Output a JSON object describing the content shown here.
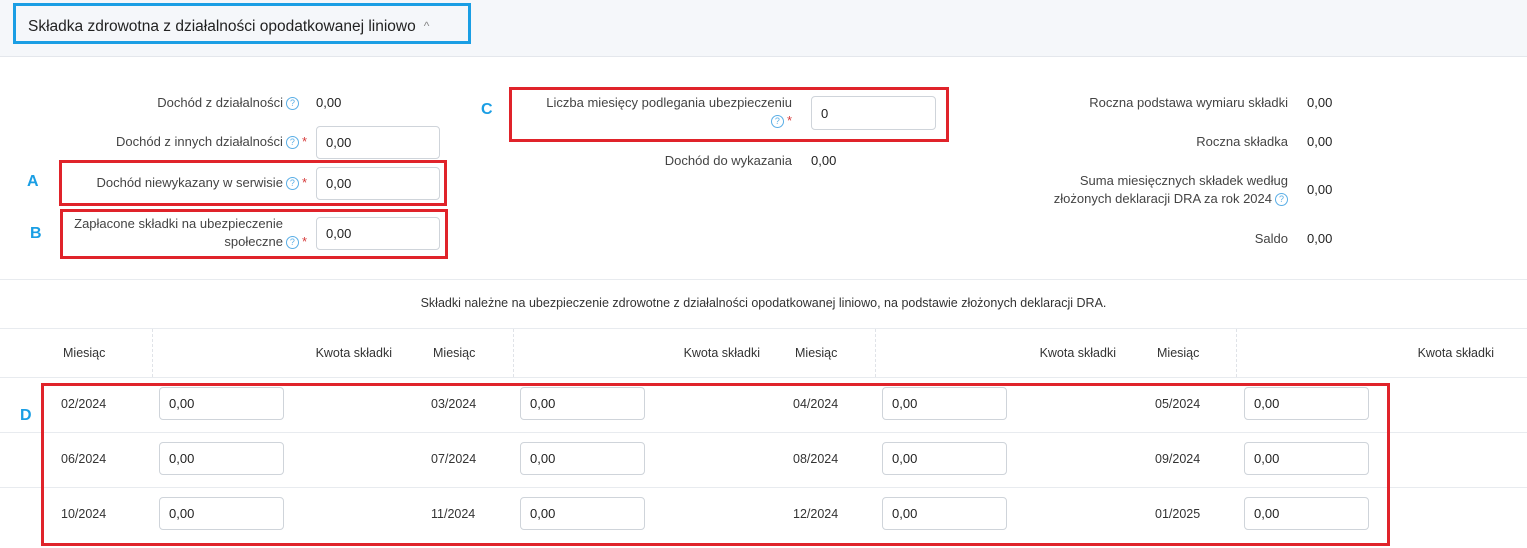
{
  "section": {
    "title": "Składka zdrowotna z działalności opodatkowanej liniowo",
    "chevron": "^"
  },
  "left": {
    "dochod_dzialalnosci": {
      "label": "Dochód z działalności",
      "value": "0,00"
    },
    "dochod_innych": {
      "label": "Dochód z innych działalności",
      "value": "0,00"
    },
    "dochod_niewykazany": {
      "label": "Dochód niewykazany w serwisie",
      "value": "0,00"
    },
    "zaplacone_skladki": {
      "label_line1": "Zapłacone składki na ubezpieczenie",
      "label_line2": "społeczne",
      "value": "0,00"
    }
  },
  "middle": {
    "liczba_miesiecy": {
      "label": "Liczba miesięcy podlegania ubezpieczeniu",
      "value": "0"
    },
    "dochod_do_wykazania": {
      "label": "Dochód do wykazania",
      "value": "0,00"
    }
  },
  "right": {
    "roczna_podstawa": {
      "label": "Roczna podstawa wymiaru składki",
      "value": "0,00"
    },
    "roczna_skladka": {
      "label": "Roczna składka",
      "value": "0,00"
    },
    "suma_miesiecznych": {
      "label_line1": "Suma miesięcznych składek według",
      "label_line2": "złożonych deklaracji DRA za rok 2024",
      "value": "0,00"
    },
    "saldo": {
      "label": "Saldo",
      "value": "0,00"
    }
  },
  "annotations": {
    "a": "A",
    "b": "B",
    "c": "C",
    "d": "D"
  },
  "icons": {
    "help": "help-circle-icon",
    "chevron": "chevron-up-icon"
  },
  "colors": {
    "highlight": "#e0232a",
    "accent": "#1a9ee4",
    "required": "#d63a3a"
  },
  "required_mark": "*",
  "help_glyph": "?",
  "table": {
    "caption": "Składki należne na ubezpieczenie zdrowotne z działalności opodatkowanej liniowo, na podstawie złożonych deklaracji DRA.",
    "headers": {
      "month": "Miesiąc",
      "amount": "Kwota składki"
    },
    "rows": [
      [
        {
          "month": "02/2024",
          "amount": "0,00"
        },
        {
          "month": "03/2024",
          "amount": "0,00"
        },
        {
          "month": "04/2024",
          "amount": "0,00"
        },
        {
          "month": "05/2024",
          "amount": "0,00"
        }
      ],
      [
        {
          "month": "06/2024",
          "amount": "0,00"
        },
        {
          "month": "07/2024",
          "amount": "0,00"
        },
        {
          "month": "08/2024",
          "amount": "0,00"
        },
        {
          "month": "09/2024",
          "amount": "0,00"
        }
      ],
      [
        {
          "month": "10/2024",
          "amount": "0,00"
        },
        {
          "month": "11/2024",
          "amount": "0,00"
        },
        {
          "month": "12/2024",
          "amount": "0,00"
        },
        {
          "month": "01/2025",
          "amount": "0,00"
        }
      ]
    ]
  }
}
